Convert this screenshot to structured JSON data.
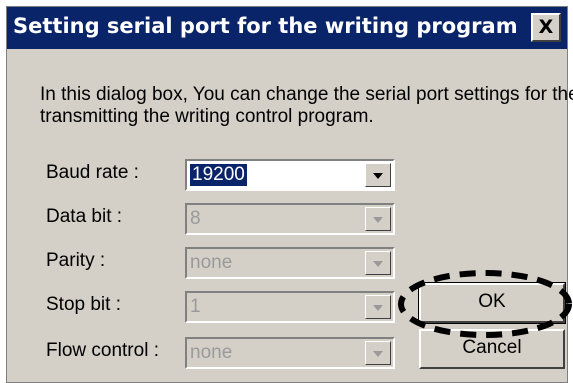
{
  "dialog": {
    "title": "Setting serial port for the writing program",
    "close_label": "X",
    "description": "In this dialog box, You can change the serial port settings for the transmitting  the writing control program."
  },
  "fields": [
    {
      "label": "Baud rate :",
      "value": "19200",
      "enabled": true,
      "selected": true
    },
    {
      "label": "Data bit :",
      "value": "8",
      "enabled": false
    },
    {
      "label": "Parity :",
      "value": "none",
      "enabled": false
    },
    {
      "label": "Stop bit :",
      "value": "1",
      "enabled": false
    },
    {
      "label": "Flow control :",
      "value": "none",
      "enabled": false
    }
  ],
  "buttons": {
    "ok": "OK",
    "cancel": "Cancel"
  },
  "colors": {
    "titlebar": "#0a246a",
    "dialog_face": "#d4d0c8",
    "highlight_annotation": "#000000"
  },
  "icons": {
    "close": "close-icon",
    "dropdown": "chevron-down-icon"
  }
}
